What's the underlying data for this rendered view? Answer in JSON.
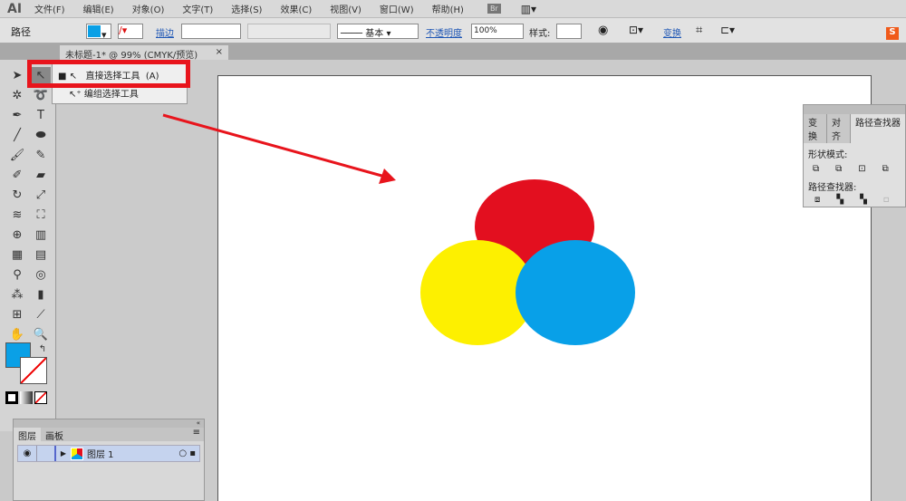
{
  "app": {
    "logo": "AI"
  },
  "menu": [
    "文件(F)",
    "编辑(E)",
    "对象(O)",
    "文字(T)",
    "选择(S)",
    "效果(C)",
    "视图(V)",
    "窗口(W)",
    "帮助(H)"
  ],
  "menu_extra": {
    "bridge": "Br"
  },
  "control": {
    "selection_type": "路径",
    "fill_color": "#0aa0e6",
    "stroke_label": "描边",
    "brush_label": "基本",
    "opacity_label": "不透明度",
    "opacity_value": "100%",
    "style_label": "样式:",
    "transform_label": "变换"
  },
  "document_tab": {
    "title": "未标题-1* @ 99% (CMYK/预览)",
    "close": "×"
  },
  "flyout": {
    "items": [
      {
        "label": "直接选择工具",
        "shortcut": "(A)",
        "active": true
      },
      {
        "label": "编组选择工具"
      }
    ]
  },
  "pathfinder": {
    "tabs": [
      "变换",
      "对齐",
      "路径查找器"
    ],
    "shape_modes_label": "形状模式:",
    "pathfinders_label": "路径查找器:"
  },
  "layers": {
    "tabs": [
      "图层",
      "画板"
    ],
    "rows": [
      {
        "name": "图层 1"
      }
    ]
  },
  "colors": {
    "red": "#e30f1f",
    "yellow": "#fdf000",
    "blue": "#08a0e8",
    "highlight": "#e8141c"
  }
}
